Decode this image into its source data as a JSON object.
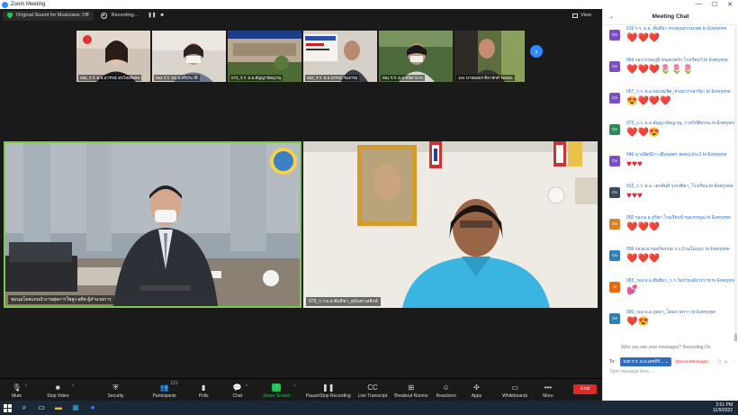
{
  "window": {
    "title": "Zoom Meeting"
  },
  "topbar": {
    "sound_label": "Original Sound for Musicians: Off",
    "recording_label": "Recording...",
    "view_label": "View"
  },
  "thumbnails": [
    {
      "name": "095_ร.ร. ผ.อ.สุวรรณ์ สุขโสมพิเศษ"
    },
    {
      "name": "054 ร.ร. มบ.ธ.ศรีประวัติ"
    },
    {
      "name": "073_ร.ร. ผ.อ.สัญญาจัดญาณุ"
    },
    {
      "name": "092_ร.ร. ผ.อ.บรรจบ รองกรม"
    },
    {
      "name": "091 ร.ร. ผ.อ.ชนิดาบาล"
    },
    {
      "name": "104 นายพอพร ศิลาสักค์ รองผอ."
    }
  ],
  "main_videos": [
    {
      "name": "ชุมนุมโดยแกนนำงานศุลการใชสูง อดีต ผู้อำนวยการ"
    },
    {
      "name": "079_ร.ร.ผ.อ.พันธิชา_สุนันทาเลอิกษ์"
    }
  ],
  "toolbar": {
    "mute": "Mute",
    "stop_video": "Stop Video",
    "security": "Security",
    "participants": "Participants",
    "participants_count": "121",
    "polls": "Polls",
    "chat": "Chat",
    "share_screen": "Share Screen",
    "pause_recording": "Pause/Stop Recording",
    "live_transcript": "Live Transcript",
    "breakout_rooms": "Breakout Rooms",
    "reactions": "Reactions",
    "apps": "Apps",
    "whiteboards": "Whiteboards",
    "more": "More",
    "end": "End"
  },
  "chat": {
    "title": "Meeting Chat",
    "to_everyone": "to Everyone",
    "messages": [
      {
        "initials": "Ov",
        "color": "#7b4fc2",
        "sender": "016 ร.ร. ผ.อ. พันสินา ทรงคุณธรรมเขต",
        "emoji": "❤️❤️❤️"
      },
      {
        "initials": "Ov",
        "color": "#7b4fc2",
        "sender": "064 รองวรรณภูมิ ทนเตรพรัก โรงเรียนวิ",
        "emoji": "❤️❤️❤️🌷🌷🌷"
      },
      {
        "initials": "Ov",
        "color": "#7b4fc2",
        "sender": "067_ร.ร. ผ.อ.ขอเขมจิต_ทรงมากรสารัฐา",
        "emoji": "😍❤️❤️❤️"
      },
      {
        "initials": "Ov",
        "color": "#2e8b57",
        "sender": "073_ร.ร. ผ.อ.สัญญาจัดญาณุ_รายวิบัติธรรม",
        "emoji": "❤️❤️😍"
      },
      {
        "initials": "Ov",
        "color": "#7b4fc2",
        "sender": "046 นายนิตนีกา เตือนคตร สคผป.ประ2",
        "emoji": "♥♥♥"
      },
      {
        "initials": "Ov",
        "color": "#3c4a5c",
        "sender": "012_ร.ร. ผ.อ. เตรพ์นสิ รุงรงพิชา_โรงเรียน",
        "emoji": "♥♥♥"
      },
      {
        "initials": "Ov",
        "color": "#d9822b",
        "sender": "050 รอง ผ.อ.ภูริต่า โรงเรียนบ้านดุงรหนุน",
        "emoji": "❤️❤️❤️"
      },
      {
        "initials": "Ov",
        "color": "#2d7fb8",
        "sender": "056 รองผ.อ.กมลรัตรรณ ร.ร.บ้านโนนนา",
        "emoji": "❤️❤️❤️"
      },
      {
        "initials": "O",
        "color": "#e86a10",
        "sender": "083_รอง ผ.อ.พันทิมา_ร.ร.วัดป่ายงสังวรราช",
        "emoji": "💕"
      },
      {
        "initials": "Ov",
        "color": "#2d7fb8",
        "sender": "090_รอง ผ.อ.บุษบา_โคมกาลราา",
        "emoji": "❤️😍"
      }
    ],
    "who_can_see": "Who can see your messages? Recording On",
    "to_label": "To:",
    "to_selected": "038 ร.ร. ผ.อ.เตศทีร์...",
    "direct_message": "(Direct Message)",
    "input_placeholder": "Type message here..."
  },
  "taskbar": {
    "time": "2:51 PM",
    "date": "11/9/2022"
  }
}
